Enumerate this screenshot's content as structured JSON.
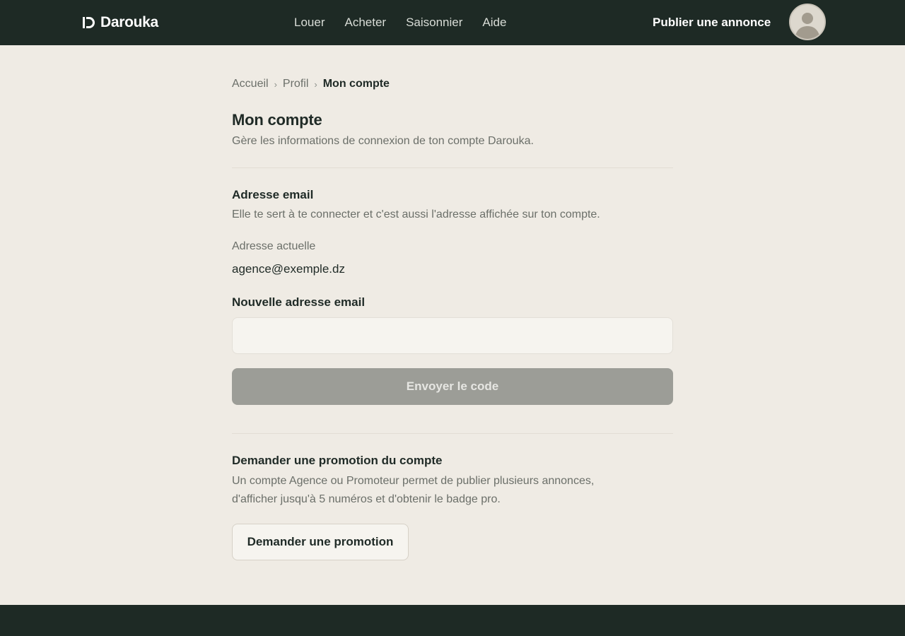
{
  "header": {
    "brand": "Darouka",
    "nav": [
      "Louer",
      "Acheter",
      "Saisonnier",
      "Aide"
    ],
    "publish_label": "Publier une annonce"
  },
  "breadcrumb": {
    "items": [
      "Accueil",
      "Profil"
    ],
    "current": "Mon compte",
    "separator": "›"
  },
  "page": {
    "title": "Mon compte",
    "subtitle": "Gère les informations de connexion de ton compte Darouka."
  },
  "email_section": {
    "title": "Adresse email",
    "description": "Elle te sert à te connecter et c'est aussi l'adresse affichée sur ton compte.",
    "current_label": "Adresse actuelle",
    "current_value": "agence@exemple.dz",
    "new_label": "Nouvelle adresse email",
    "new_value": "",
    "submit_label": "Envoyer le code"
  },
  "promotion_section": {
    "title": "Demander une promotion du compte",
    "description_line1": "Un compte Agence ou Promoteur permet de publier plusieurs annonces,",
    "description_line2": "d'afficher jusqu'à 5 numéros et d'obtenir le badge pro.",
    "button_label": "Demander une promotion"
  },
  "colors": {
    "header_bg": "#1e2a25",
    "page_bg": "#efebe4",
    "disabled_button": "#9c9d97"
  },
  "icons": [
    "brand-logo-icon",
    "avatar-icon",
    "chevron-right-icon"
  ]
}
